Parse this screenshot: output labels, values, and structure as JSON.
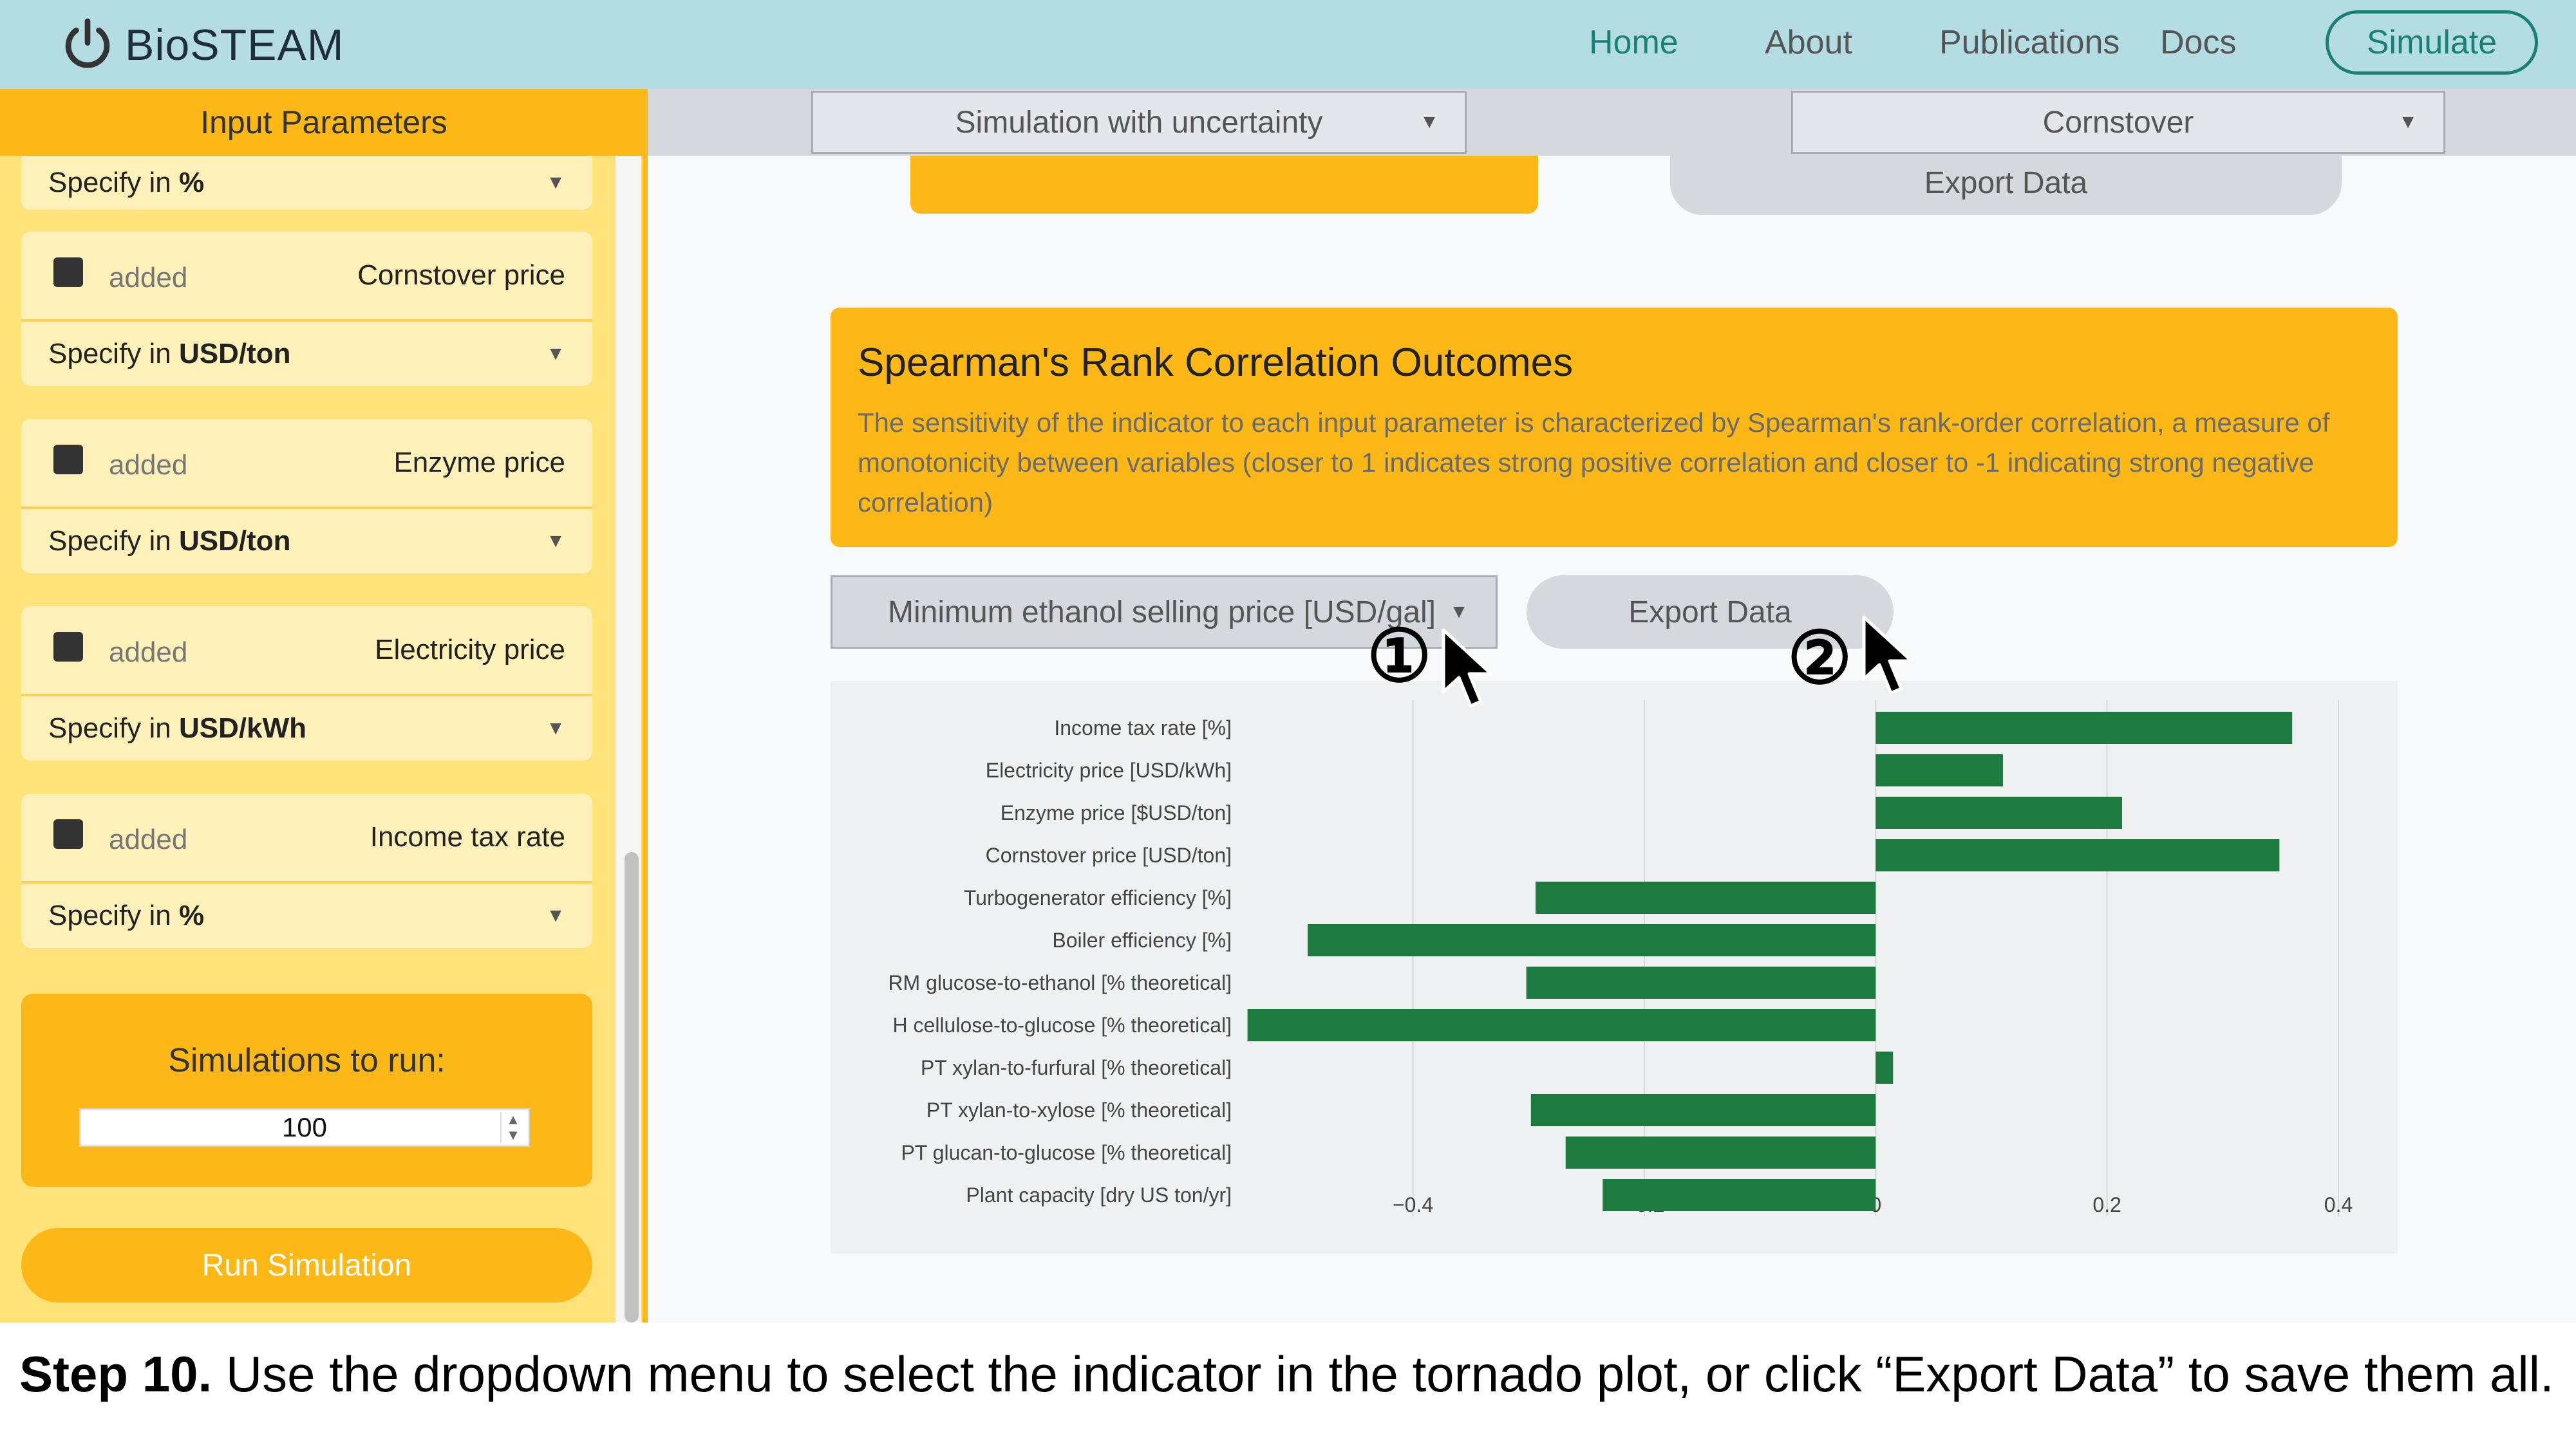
{
  "navbar": {
    "brand": "BioSTEAM",
    "items": [
      "Home",
      "About",
      "Publications",
      "Docs"
    ],
    "simulate_label": "Simulate"
  },
  "sidebar": {
    "title": "Input Parameters",
    "first_specify": {
      "prefix": "Specify in",
      "unit": "%"
    },
    "added_label": "added",
    "specify_prefix": "Specify in",
    "params": [
      {
        "name": "Cornstover price",
        "unit": "USD/ton"
      },
      {
        "name": "Enzyme price",
        "unit": "USD/ton"
      },
      {
        "name": "Electricity price",
        "unit": "USD/kWh"
      },
      {
        "name": "Income tax rate",
        "unit": "%"
      }
    ],
    "simulations_label": "Simulations to run:",
    "simulations_value": "100",
    "run_label": "Run Simulation"
  },
  "main": {
    "mode_select": "Simulation with uncertainty",
    "feedstock_select": "Cornstover",
    "export_top_label": "Export Data",
    "spearman": {
      "title": "Spearman's Rank Correlation Outcomes",
      "description": "The sensitivity of the indicator to each input parameter is characterized by Spearman's rank-order correlation, a measure of monotonicity between variables (closer to 1 indicates strong positive correlation and closer to -1 indicating strong negative correlation)"
    },
    "indicator_select": "Minimum ethanol selling price [USD/gal]",
    "export_label": "Export Data"
  },
  "annotations": {
    "marker_1": "①",
    "marker_2": "②"
  },
  "caption": {
    "step": "Step 10.",
    "text": "Use the dropdown menu to select the indicator in the tornado plot, or click “Export Data” to save them all."
  },
  "colors": {
    "bar": "#1e7b3f",
    "orange": "#fcb816",
    "teal": "#1a7f74"
  },
  "chart_data": {
    "type": "bar",
    "orientation": "horizontal",
    "categories": [
      "Income tax rate [%]",
      "Electricity price [USD/kWh]",
      "Enzyme price [$USD/ton]",
      "Cornstover price [USD/ton]",
      "Turbogenerator efficiency [%]",
      "Boiler efficiency [%]",
      "RM glucose-to-ethanol [% theoretical]",
      "H cellulose-to-glucose [% theoretical]",
      "PT xylan-to-furfural [% theoretical]",
      "PT xylan-to-xylose [% theoretical]",
      "PT glucan-to-glucose [% theoretical]",
      "Plant capacity [dry US ton/yr]"
    ],
    "values": [
      0.36,
      0.11,
      0.213,
      0.349,
      -0.294,
      -0.491,
      -0.302,
      -0.543,
      0.015,
      -0.298,
      -0.268,
      -0.236
    ],
    "xlim": [
      -0.55,
      0.41
    ],
    "xticks": [
      -0.4,
      -0.2,
      0,
      0.2,
      0.4
    ],
    "xtick_labels": [
      "−0.4",
      "−0.2",
      "0",
      "0.2",
      "0.4"
    ],
    "grid": true
  }
}
